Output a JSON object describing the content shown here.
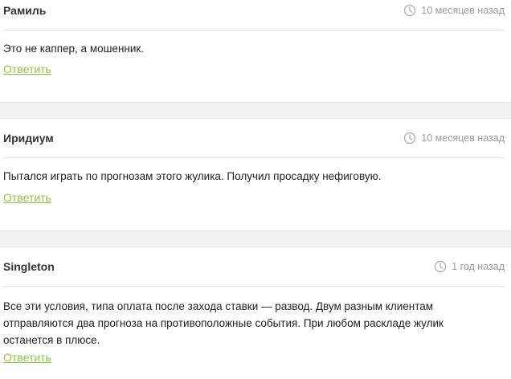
{
  "comments": [
    {
      "author": "Рамиль",
      "time": "10 месяцев назад",
      "text": "Это не каппер, а мошенник.",
      "reply_label": "Ответить",
      "time_icon": "clock-icon"
    },
    {
      "author": "Иридиум",
      "time": "10 месяцев назад",
      "text": "Пытался играть по прогнозам этого жулика. Получил просадку нефиговую.",
      "reply_label": "Ответить",
      "time_icon": "clock-icon"
    },
    {
      "author": "Singleton",
      "time": "1 год назад",
      "text": "Все эти условия, типа оплата после захода ставки — развод. Двум разным клиентам\nотправляются два прогноза на противоположные события. При любом раскладе жулик\nостанется в плюсе.",
      "reply_label": "Ответить",
      "time_icon": "clock-icon"
    }
  ],
  "colors": {
    "reply_link": "#8bc34a",
    "meta_text": "#9a9a9a",
    "separator": "#f2f2f2"
  }
}
